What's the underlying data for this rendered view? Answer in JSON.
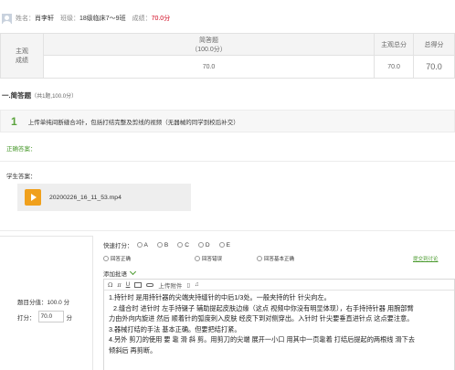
{
  "student": {
    "name_label": "姓名：",
    "name": "肖李轩",
    "class_label": "班级：",
    "class": "18级临床7～9班",
    "score_label": "成绩：",
    "score": "70.0分"
  },
  "score_table": {
    "subjective_label_1": "主观",
    "subjective_label_2": "成绩",
    "qa_title": "简答题",
    "qa_points": "（100.0分）",
    "subjective_total": "主观总分",
    "total": "总得分",
    "qa_value": "70.0",
    "subjective_total_value": "70.0",
    "total_value": "70.0"
  },
  "section": {
    "title": "一.简答题",
    "meta": "（共1题,100.0分）"
  },
  "question": {
    "number": "1",
    "text": "上传单纯间断缝合3针，包括打结完整及剪线的视频（无器械的同学到校后补交）"
  },
  "correct_answer_label": "正确答案：",
  "student_answer_label": "学生答案：",
  "attachment": {
    "file_name": "20200226_16_11_53.mp4",
    "icon": "play-icon",
    "color": "#f0a01c"
  },
  "grading": {
    "full_score": "题目分值：100.0 分",
    "score_label": "打分：",
    "score_value": "70.0",
    "score_unit": "分",
    "quick_label": "快速打分：",
    "grades": [
      "A",
      "B",
      "C",
      "D",
      "E"
    ],
    "comments": [
      "回答正确",
      "回答错误",
      "回答基本正确"
    ],
    "discussion_link": "提交到讨论",
    "add_note": "添加批语",
    "toolbar_upload": "上传附件"
  },
  "editor_lines": [
    "1.持针时 是用持针器的尖端夹持缝针的中后1/3处。一般夹持的针 针尖向左。",
    "2.缝合时 进针时 左手持镊子 辅助提起皮肤边缘（这点 视频中你没有明显体现），右手持持针器 用腕部臂",
    "力由外向内旋进 然后 顺着针的弧度刺入皮肤 经皮下到对侧穿出。入针时 针尖要垂直进针点 这点要注意。",
    "3.器械打结的手法 基本正确。但要把结打紧。",
    "4.另外 剪刀的使用 要 靠 滑 斜 剪。用剪刀的尖端 展开一小口 用其中一页靠着 打结后提起的两根线 滑下去",
    "倾斜后 再剪断。"
  ],
  "colors": {
    "accent_green": "#4a9a2e",
    "score_red": "#d0021b"
  }
}
